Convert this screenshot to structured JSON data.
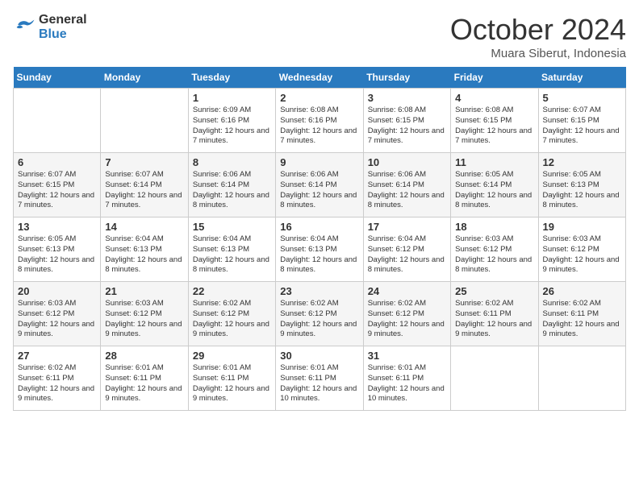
{
  "header": {
    "logo_line1": "General",
    "logo_line2": "Blue",
    "month": "October 2024",
    "location": "Muara Siberut, Indonesia"
  },
  "weekdays": [
    "Sunday",
    "Monday",
    "Tuesday",
    "Wednesday",
    "Thursday",
    "Friday",
    "Saturday"
  ],
  "weeks": [
    [
      {
        "day": "",
        "info": ""
      },
      {
        "day": "",
        "info": ""
      },
      {
        "day": "1",
        "info": "Sunrise: 6:09 AM\nSunset: 6:16 PM\nDaylight: 12 hours\nand 7 minutes."
      },
      {
        "day": "2",
        "info": "Sunrise: 6:08 AM\nSunset: 6:16 PM\nDaylight: 12 hours\nand 7 minutes."
      },
      {
        "day": "3",
        "info": "Sunrise: 6:08 AM\nSunset: 6:15 PM\nDaylight: 12 hours\nand 7 minutes."
      },
      {
        "day": "4",
        "info": "Sunrise: 6:08 AM\nSunset: 6:15 PM\nDaylight: 12 hours\nand 7 minutes."
      },
      {
        "day": "5",
        "info": "Sunrise: 6:07 AM\nSunset: 6:15 PM\nDaylight: 12 hours\nand 7 minutes."
      }
    ],
    [
      {
        "day": "6",
        "info": "Sunrise: 6:07 AM\nSunset: 6:15 PM\nDaylight: 12 hours\nand 7 minutes."
      },
      {
        "day": "7",
        "info": "Sunrise: 6:07 AM\nSunset: 6:14 PM\nDaylight: 12 hours\nand 7 minutes."
      },
      {
        "day": "8",
        "info": "Sunrise: 6:06 AM\nSunset: 6:14 PM\nDaylight: 12 hours\nand 8 minutes."
      },
      {
        "day": "9",
        "info": "Sunrise: 6:06 AM\nSunset: 6:14 PM\nDaylight: 12 hours\nand 8 minutes."
      },
      {
        "day": "10",
        "info": "Sunrise: 6:06 AM\nSunset: 6:14 PM\nDaylight: 12 hours\nand 8 minutes."
      },
      {
        "day": "11",
        "info": "Sunrise: 6:05 AM\nSunset: 6:14 PM\nDaylight: 12 hours\nand 8 minutes."
      },
      {
        "day": "12",
        "info": "Sunrise: 6:05 AM\nSunset: 6:13 PM\nDaylight: 12 hours\nand 8 minutes."
      }
    ],
    [
      {
        "day": "13",
        "info": "Sunrise: 6:05 AM\nSunset: 6:13 PM\nDaylight: 12 hours\nand 8 minutes."
      },
      {
        "day": "14",
        "info": "Sunrise: 6:04 AM\nSunset: 6:13 PM\nDaylight: 12 hours\nand 8 minutes."
      },
      {
        "day": "15",
        "info": "Sunrise: 6:04 AM\nSunset: 6:13 PM\nDaylight: 12 hours\nand 8 minutes."
      },
      {
        "day": "16",
        "info": "Sunrise: 6:04 AM\nSunset: 6:13 PM\nDaylight: 12 hours\nand 8 minutes."
      },
      {
        "day": "17",
        "info": "Sunrise: 6:04 AM\nSunset: 6:12 PM\nDaylight: 12 hours\nand 8 minutes."
      },
      {
        "day": "18",
        "info": "Sunrise: 6:03 AM\nSunset: 6:12 PM\nDaylight: 12 hours\nand 8 minutes."
      },
      {
        "day": "19",
        "info": "Sunrise: 6:03 AM\nSunset: 6:12 PM\nDaylight: 12 hours\nand 9 minutes."
      }
    ],
    [
      {
        "day": "20",
        "info": "Sunrise: 6:03 AM\nSunset: 6:12 PM\nDaylight: 12 hours\nand 9 minutes."
      },
      {
        "day": "21",
        "info": "Sunrise: 6:03 AM\nSunset: 6:12 PM\nDaylight: 12 hours\nand 9 minutes."
      },
      {
        "day": "22",
        "info": "Sunrise: 6:02 AM\nSunset: 6:12 PM\nDaylight: 12 hours\nand 9 minutes."
      },
      {
        "day": "23",
        "info": "Sunrise: 6:02 AM\nSunset: 6:12 PM\nDaylight: 12 hours\nand 9 minutes."
      },
      {
        "day": "24",
        "info": "Sunrise: 6:02 AM\nSunset: 6:12 PM\nDaylight: 12 hours\nand 9 minutes."
      },
      {
        "day": "25",
        "info": "Sunrise: 6:02 AM\nSunset: 6:11 PM\nDaylight: 12 hours\nand 9 minutes."
      },
      {
        "day": "26",
        "info": "Sunrise: 6:02 AM\nSunset: 6:11 PM\nDaylight: 12 hours\nand 9 minutes."
      }
    ],
    [
      {
        "day": "27",
        "info": "Sunrise: 6:02 AM\nSunset: 6:11 PM\nDaylight: 12 hours\nand 9 minutes."
      },
      {
        "day": "28",
        "info": "Sunrise: 6:01 AM\nSunset: 6:11 PM\nDaylight: 12 hours\nand 9 minutes."
      },
      {
        "day": "29",
        "info": "Sunrise: 6:01 AM\nSunset: 6:11 PM\nDaylight: 12 hours\nand 9 minutes."
      },
      {
        "day": "30",
        "info": "Sunrise: 6:01 AM\nSunset: 6:11 PM\nDaylight: 12 hours\nand 10 minutes."
      },
      {
        "day": "31",
        "info": "Sunrise: 6:01 AM\nSunset: 6:11 PM\nDaylight: 12 hours\nand 10 minutes."
      },
      {
        "day": "",
        "info": ""
      },
      {
        "day": "",
        "info": ""
      }
    ]
  ]
}
